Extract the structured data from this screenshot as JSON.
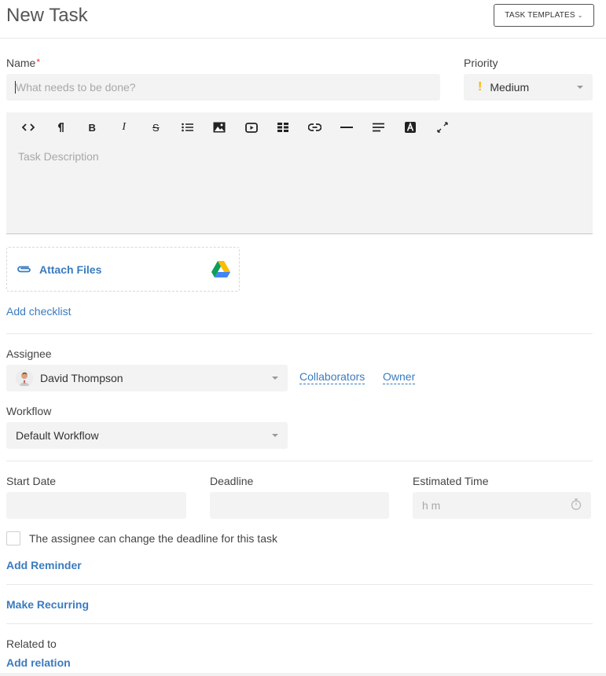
{
  "header": {
    "title": "New Task",
    "templates_button": "TASK TEMPLATES",
    "templates_chevron": "⌄"
  },
  "name": {
    "label": "Name",
    "required_mark": "*",
    "placeholder": "What needs to be done?",
    "value": ""
  },
  "priority": {
    "label": "Priority",
    "icon": "exclamation-icon",
    "icon_glyph": "!",
    "value": "Medium",
    "accent_color": "#f5b800"
  },
  "editor": {
    "toolbar": [
      {
        "name": "code-view-icon",
        "glyph": "<>"
      },
      {
        "name": "paragraph-icon",
        "glyph": "¶"
      },
      {
        "name": "bold-icon",
        "glyph": "B"
      },
      {
        "name": "italic-icon",
        "glyph": "I"
      },
      {
        "name": "strikethrough-icon",
        "glyph": "S"
      },
      {
        "name": "bullet-list-icon",
        "glyph": ""
      },
      {
        "name": "image-icon",
        "glyph": ""
      },
      {
        "name": "video-icon",
        "glyph": ""
      },
      {
        "name": "table-icon",
        "glyph": ""
      },
      {
        "name": "link-icon",
        "glyph": ""
      },
      {
        "name": "horizontal-rule-icon",
        "glyph": ""
      },
      {
        "name": "align-icon",
        "glyph": ""
      },
      {
        "name": "text-color-icon",
        "glyph": "A"
      },
      {
        "name": "fullscreen-icon",
        "glyph": ""
      }
    ],
    "placeholder": "Task Description"
  },
  "attach": {
    "label": "Attach Files",
    "icon": "paperclip-icon",
    "drive_icon": "google-drive-icon"
  },
  "checklist": {
    "add_label": "Add checklist"
  },
  "assignee": {
    "label": "Assignee",
    "value": "David Thompson",
    "collaborators_link": "Collaborators",
    "owner_link": "Owner"
  },
  "workflow": {
    "label": "Workflow",
    "value": "Default Workflow"
  },
  "dates": {
    "start_label": "Start Date",
    "start_value": "",
    "deadline_label": "Deadline",
    "deadline_value": "",
    "estimated_label": "Estimated Time",
    "estimated_placeholder": "h m"
  },
  "deadline_permission": {
    "label": "The assignee can change the deadline for this task",
    "checked": false
  },
  "reminder": {
    "label": "Add Reminder"
  },
  "recurring": {
    "label": "Make Recurring"
  },
  "related": {
    "label": "Related to",
    "add_label": "Add relation"
  },
  "colors": {
    "link": "#3a7bbf",
    "field_bg": "#f3f3f3",
    "required": "#e53935"
  }
}
